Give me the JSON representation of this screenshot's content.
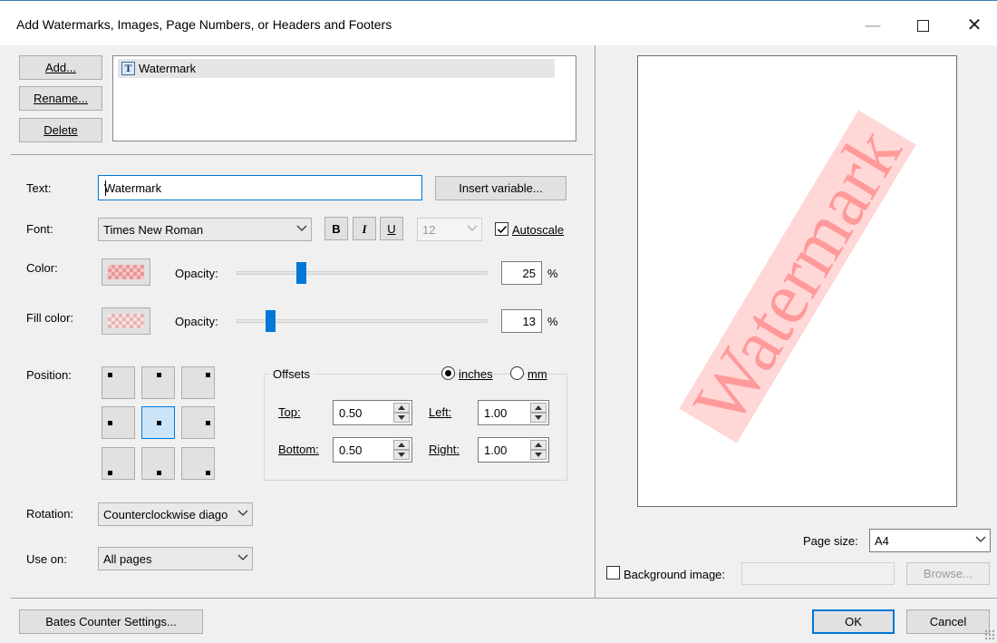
{
  "window": {
    "title": "Add Watermarks, Images, Page Numbers, or Headers and Footers",
    "minimize": "—",
    "close": "✕"
  },
  "list": {
    "add_button": "Add...",
    "rename_button": "Rename...",
    "delete_button": "Delete",
    "items": [
      {
        "icon": "T",
        "label": "Watermark"
      }
    ]
  },
  "text": {
    "label": "Text:",
    "value": "Watermark",
    "insert_variable_button": "Insert variable..."
  },
  "font": {
    "label": "Font:",
    "family": "Times New Roman",
    "bold": "B",
    "italic": "I",
    "underline": "U",
    "size": "12",
    "autoscale_label": "Autoscale",
    "autoscale_checked": true
  },
  "color": {
    "label": "Color:",
    "opacity_label": "Opacity:",
    "opacity": "25",
    "opacity_fraction": 0.25,
    "percent": "%",
    "swatch": "#f4a8a8"
  },
  "fill_color": {
    "label": "Fill color:",
    "opacity_label": "Opacity:",
    "opacity": "13",
    "opacity_fraction": 0.13,
    "percent": "%",
    "swatch": "#f6d2d2"
  },
  "position": {
    "label": "Position:",
    "selected": "center"
  },
  "offsets": {
    "label": "Offsets",
    "unit_inches": "inches",
    "unit_mm": "mm",
    "selected_unit": "inches",
    "top_label": "Top:",
    "top": "0.50",
    "bottom_label": "Bottom:",
    "bottom": "0.50",
    "left_label": "Left:",
    "left": "1.00",
    "right_label": "Right:",
    "right": "1.00"
  },
  "rotation": {
    "label": "Rotation:",
    "value": "Counterclockwise diago"
  },
  "use_on": {
    "label": "Use on:",
    "value": "All pages"
  },
  "preview": {
    "watermark_text": "Watermark",
    "watermark_color": "#ff9a9a",
    "page_size_label": "Page size:",
    "page_size": "A4",
    "background_image_label": "Background image:",
    "background_image_checked": false,
    "browse_button": "Browse..."
  },
  "footer": {
    "bates_button": "Bates Counter Settings...",
    "ok_button": "OK",
    "cancel_button": "Cancel"
  }
}
